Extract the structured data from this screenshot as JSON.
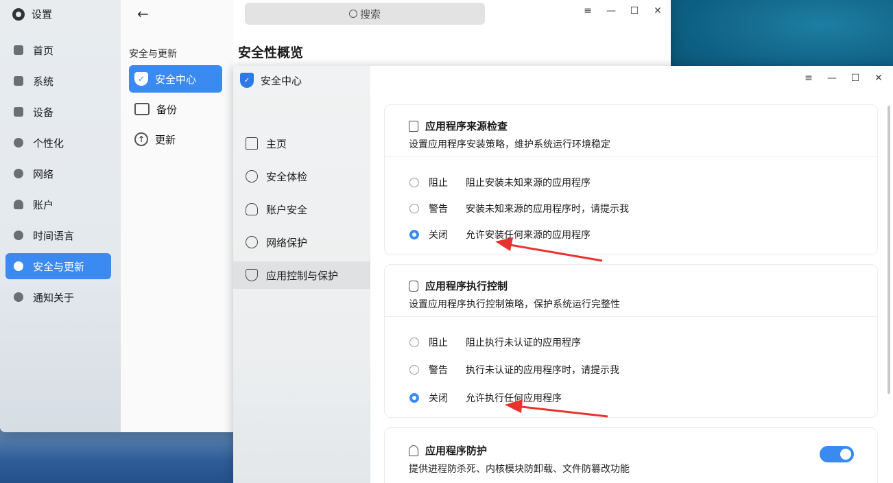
{
  "settings": {
    "app_title": "设置",
    "nav": [
      {
        "label": "首页",
        "icon": "home-icon"
      },
      {
        "label": "系统",
        "icon": "monitor-icon"
      },
      {
        "label": "设备",
        "icon": "tools-icon"
      },
      {
        "label": "个性化",
        "icon": "palette-icon"
      },
      {
        "label": "网络",
        "icon": "globe-icon"
      },
      {
        "label": "账户",
        "icon": "user-icon"
      },
      {
        "label": "时间语言",
        "icon": "clock-icon"
      },
      {
        "label": "安全与更新",
        "icon": "security-icon",
        "active": true
      },
      {
        "label": "通知关于",
        "icon": "info-icon"
      }
    ],
    "sub_group_title": "安全与更新",
    "sub_items": [
      {
        "label": "安全中心",
        "icon": "shield-icon",
        "active": true
      },
      {
        "label": "备份",
        "icon": "backup-icon"
      },
      {
        "label": "更新",
        "icon": "update-icon"
      }
    ],
    "search_placeholder": "搜索",
    "page_title": "安全性概览",
    "window_controls": [
      "≡",
      "—",
      "☐",
      "✕"
    ]
  },
  "security_center": {
    "title": "安全中心",
    "nav": [
      {
        "label": "主页",
        "icon": "home-icon"
      },
      {
        "label": "安全体检",
        "icon": "scan-icon"
      },
      {
        "label": "账户安全",
        "icon": "user-icon"
      },
      {
        "label": "网络保护",
        "icon": "globe-icon"
      },
      {
        "label": "应用控制与保护",
        "icon": "shield-check-icon",
        "active": true
      }
    ],
    "window_controls": [
      "≡",
      "—",
      "☐",
      "✕"
    ],
    "cards": [
      {
        "title": "应用程序来源检查",
        "desc": "设置应用程序安装策略，维护系统运行环境稳定",
        "options": [
          {
            "label": "阻止",
            "desc": "阻止安装未知来源的应用程序",
            "checked": false
          },
          {
            "label": "警告",
            "desc": "安装未知来源的应用程序时，请提示我",
            "checked": false
          },
          {
            "label": "关闭",
            "desc": "允许安装任何来源的应用程序",
            "checked": true
          }
        ]
      },
      {
        "title": "应用程序执行控制",
        "desc": "设置应用程序执行控制策略，保护系统运行完整性",
        "options": [
          {
            "label": "阻止",
            "desc": "阻止执行未认证的应用程序",
            "checked": false
          },
          {
            "label": "警告",
            "desc": "执行未认证的应用程序时，请提示我",
            "checked": false
          },
          {
            "label": "关闭",
            "desc": "允许执行任何应用程序",
            "checked": true
          }
        ]
      },
      {
        "title": "应用程序防护",
        "desc": "提供进程防杀死、内核模块防卸载、文件防篡改功能",
        "toggle_on": true
      }
    ]
  },
  "colors": {
    "accent": "#3a8af2",
    "annotation_arrow": "#e8322e"
  }
}
